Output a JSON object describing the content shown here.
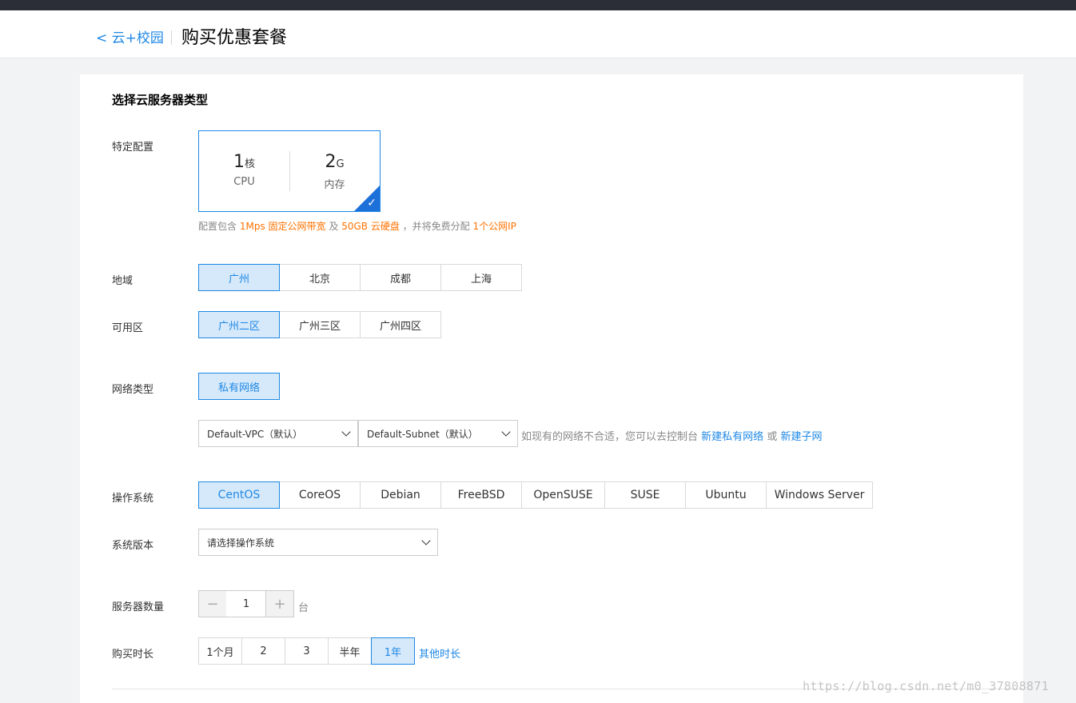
{
  "header": {
    "back_label": "< 云+校园",
    "title": "购买优惠套餐"
  },
  "section_title": "选择云服务器类型",
  "labels": {
    "config": "特定配置",
    "region": "地域",
    "zone": "可用区",
    "network_type": "网络类型",
    "os": "操作系统",
    "os_version": "系统版本",
    "server_count": "服务器数量",
    "duration": "购买时长"
  },
  "config": {
    "cpu_value": "1",
    "cpu_unit": "核",
    "cpu_label": "CPU",
    "mem_value": "2",
    "mem_unit": "G",
    "mem_label": "内存",
    "note_prefix": "配置包含",
    "note_bandwidth": "1Mps 固定公网带宽",
    "note_and": "及",
    "note_disk": "50GB 云硬盘",
    "note_mid": "，并将免费分配",
    "note_ip": "1个公网IP"
  },
  "regions": [
    "广州",
    "北京",
    "成都",
    "上海"
  ],
  "zones": [
    "广州二区",
    "广州三区",
    "广州四区"
  ],
  "network_types": [
    "私有网络"
  ],
  "network": {
    "vpc": "Default-VPC（默认）",
    "subnet": "Default-Subnet（默认）",
    "hint": "如现有的网络不合适，您可以去控制台",
    "new_vpc": "新建私有网络",
    "or": "或",
    "new_subnet": "新建子网"
  },
  "os_list": [
    "CentOS",
    "CoreOS",
    "Debian",
    "FreeBSD",
    "OpenSUSE",
    "SUSE",
    "Ubuntu",
    "Windows Server"
  ],
  "os_version_placeholder": "请选择操作系统",
  "stepper": {
    "minus": "−",
    "value": "1",
    "plus": "+",
    "unit": "台"
  },
  "durations": [
    "1个月",
    "2",
    "3",
    "半年",
    "1年"
  ],
  "other_duration": "其他时长",
  "selected": {
    "region": 0,
    "zone": 0,
    "network_type": 0,
    "os": 0,
    "duration": 4
  },
  "colors": {
    "accent": "#1e88e5",
    "highlight": "#ff7200",
    "active_bg": "#d6e9fb"
  },
  "watermark": "https://blog.csdn.net/m0_37808871"
}
